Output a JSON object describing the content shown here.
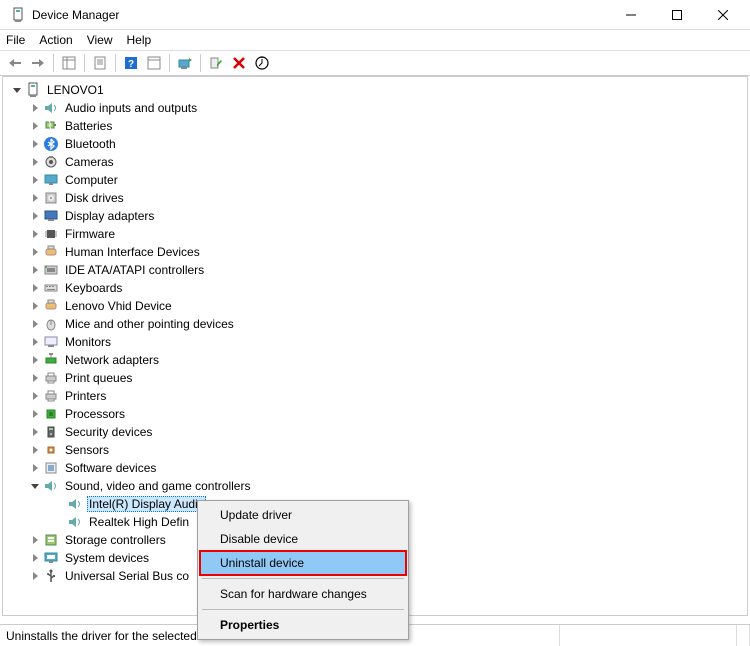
{
  "window": {
    "title": "Device Manager"
  },
  "menu": [
    "File",
    "Action",
    "View",
    "Help"
  ],
  "root": {
    "name": "LENOVO1"
  },
  "categories": [
    {
      "label": "Audio inputs and outputs",
      "icon": "speaker"
    },
    {
      "label": "Batteries",
      "icon": "battery"
    },
    {
      "label": "Bluetooth",
      "icon": "bluetooth"
    },
    {
      "label": "Cameras",
      "icon": "camera"
    },
    {
      "label": "Computer",
      "icon": "monitor"
    },
    {
      "label": "Disk drives",
      "icon": "disk"
    },
    {
      "label": "Display adapters",
      "icon": "display"
    },
    {
      "label": "Firmware",
      "icon": "chip"
    },
    {
      "label": "Human Interface Devices",
      "icon": "hid"
    },
    {
      "label": "IDE ATA/ATAPI controllers",
      "icon": "ide"
    },
    {
      "label": "Keyboards",
      "icon": "keyboard"
    },
    {
      "label": "Lenovo Vhid Device",
      "icon": "hid"
    },
    {
      "label": "Mice and other pointing devices",
      "icon": "mouse"
    },
    {
      "label": "Monitors",
      "icon": "monitor2"
    },
    {
      "label": "Network adapters",
      "icon": "network"
    },
    {
      "label": "Print queues",
      "icon": "printer"
    },
    {
      "label": "Printers",
      "icon": "printer"
    },
    {
      "label": "Processors",
      "icon": "cpu"
    },
    {
      "label": "Security devices",
      "icon": "security"
    },
    {
      "label": "Sensors",
      "icon": "sensor"
    },
    {
      "label": "Software devices",
      "icon": "software"
    }
  ],
  "expanded_category": {
    "label": "Sound, video and game controllers",
    "icon": "speaker",
    "children": [
      {
        "label": "Intel(R) Display Audio",
        "selected": true
      },
      {
        "label": "Realtek High Defin",
        "selected": false
      }
    ]
  },
  "categories_after": [
    {
      "label": "Storage controllers",
      "icon": "storage"
    },
    {
      "label": "System devices",
      "icon": "system"
    },
    {
      "label": "Universal Serial Bus co",
      "icon": "usb"
    }
  ],
  "ctx_menu": {
    "items": [
      {
        "label": "Update driver"
      },
      {
        "label": "Disable device"
      },
      {
        "label": "Uninstall device",
        "highlight": true,
        "emphasize": true
      }
    ],
    "after_sep": [
      {
        "label": "Scan for hardware changes"
      }
    ],
    "after_sep2": [
      {
        "label": "Properties",
        "bold": true
      }
    ]
  },
  "status": "Uninstalls the driver for the selected device."
}
